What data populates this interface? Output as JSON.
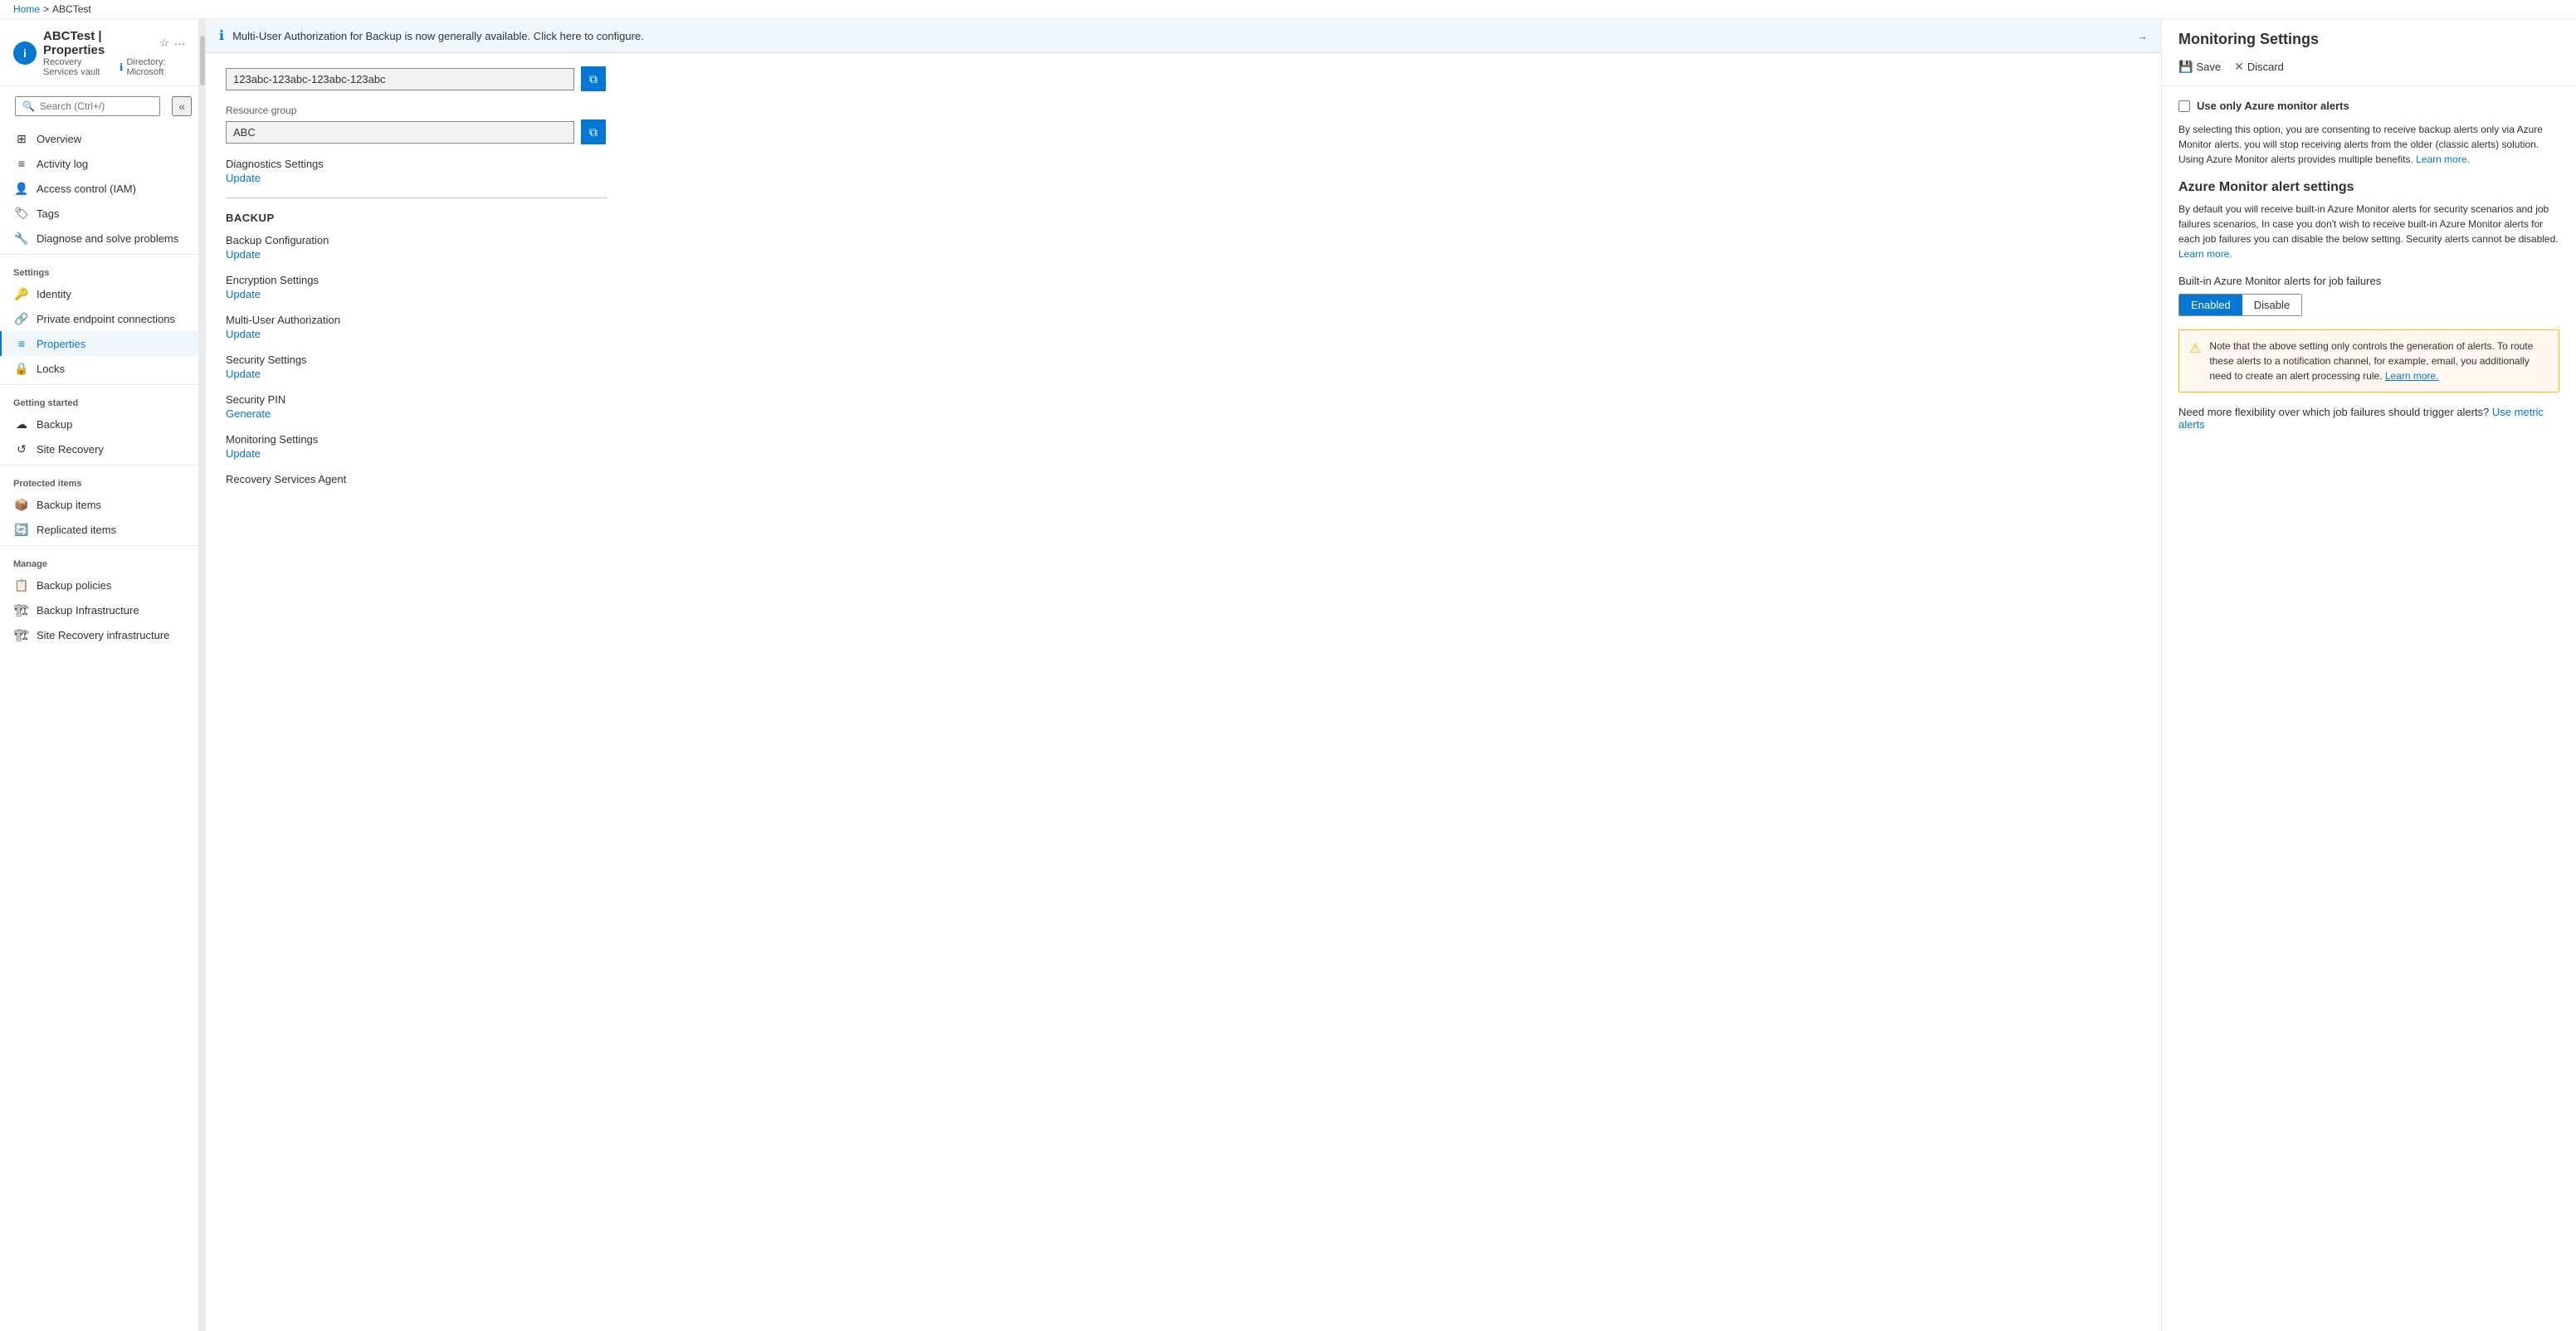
{
  "breadcrumb": {
    "home": "Home",
    "separator1": ">",
    "current": "ABCTest"
  },
  "sidebar": {
    "title": "ABCTest | Properties",
    "subtitle": "Recovery Services vault",
    "directory": "Directory: Microsoft",
    "search_placeholder": "Search (Ctrl+/)",
    "collapse_icon": "«",
    "items": [
      {
        "id": "overview",
        "label": "Overview",
        "icon": "⊞"
      },
      {
        "id": "activity-log",
        "label": "Activity log",
        "icon": "≡"
      },
      {
        "id": "access-control",
        "label": "Access control (IAM)",
        "icon": "👤"
      },
      {
        "id": "tags",
        "label": "Tags",
        "icon": "🏷"
      },
      {
        "id": "diagnose",
        "label": "Diagnose and solve problems",
        "icon": "🔧"
      }
    ],
    "sections": [
      {
        "label": "Settings",
        "items": [
          {
            "id": "identity",
            "label": "Identity",
            "icon": "🔑"
          },
          {
            "id": "private-endpoints",
            "label": "Private endpoint connections",
            "icon": "🔗"
          },
          {
            "id": "properties",
            "label": "Properties",
            "icon": "≡",
            "active": true
          },
          {
            "id": "locks",
            "label": "Locks",
            "icon": "🔒"
          }
        ]
      },
      {
        "label": "Getting started",
        "items": [
          {
            "id": "backup",
            "label": "Backup",
            "icon": "☁"
          },
          {
            "id": "site-recovery",
            "label": "Site Recovery",
            "icon": "↺"
          }
        ]
      },
      {
        "label": "Protected items",
        "items": [
          {
            "id": "backup-items",
            "label": "Backup items",
            "icon": "📦"
          },
          {
            "id": "replicated-items",
            "label": "Replicated items",
            "icon": "🔄"
          }
        ]
      },
      {
        "label": "Manage",
        "items": [
          {
            "id": "backup-policies",
            "label": "Backup policies",
            "icon": "📋"
          },
          {
            "id": "backup-infrastructure",
            "label": "Backup Infrastructure",
            "icon": "🏗"
          },
          {
            "id": "site-recovery-infra",
            "label": "Site Recovery infrastructure",
            "icon": "🏗"
          }
        ]
      }
    ]
  },
  "notification_banner": {
    "text": "Multi-User Authorization for Backup is now generally available. Click here to configure.",
    "arrow": "→"
  },
  "properties": {
    "resource_id_label": "",
    "resource_id_value": "123abc-123abc-123abc-123abc",
    "resource_group_label": "Resource group",
    "resource_group_value": "ABC",
    "diagnostics_label": "Diagnostics Settings",
    "diagnostics_update": "Update",
    "backup_section": "BACKUP",
    "backup_config_label": "Backup Configuration",
    "backup_config_update": "Update",
    "encryption_label": "Encryption Settings",
    "encryption_update": "Update",
    "multi_user_label": "Multi-User Authorization",
    "multi_user_update": "Update",
    "security_settings_label": "Security Settings",
    "security_settings_update": "Update",
    "security_pin_label": "Security PIN",
    "security_pin_generate": "Generate",
    "monitoring_label": "Monitoring Settings",
    "monitoring_update": "Update",
    "recovery_agent_label": "Recovery Services Agent"
  },
  "right_panel": {
    "title": "Monitoring Settings",
    "save_label": "Save",
    "discard_label": "Discard",
    "checkbox_label": "Use only Azure monitor alerts",
    "description1": "By selecting this option, you are consenting to receive backup alerts only via Azure Monitor alerts. you will stop receiving alerts from the older (classic alerts) solution. Using Azure Monitor alerts provides multiple benefits.",
    "learn_more_1": "Learn more.",
    "azure_monitor_title": "Azure Monitor alert settings",
    "description2": "By default you will receive built-in Azure Monitor alerts for security scenarios and job failures scenarios, In case you don't wish to receive built-in Azure Monitor alerts for each job failures you can disable the below setting. Security alerts cannot be disabled.",
    "learn_more_2": "Learn more.",
    "builtin_label": "Built-in Azure Monitor alerts for job failures",
    "toggle_enabled": "Enabled",
    "toggle_disable": "Disable",
    "alert_note": "Note that the above setting only controls the generation of alerts. To route these alerts to a notification channel, for example, email, you additionally need to create an alert processing rule.",
    "alert_learn_more": "Learn more.",
    "flexibility_text": "Need more flexibility over which job failures should trigger alerts?",
    "use_metric_link": "Use metric alerts"
  }
}
